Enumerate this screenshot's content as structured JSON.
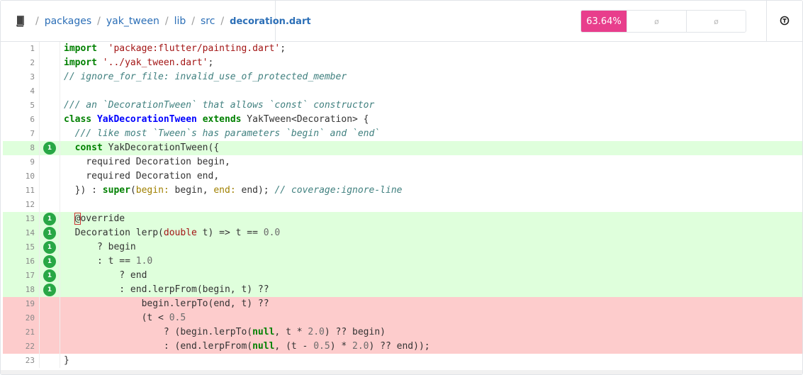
{
  "breadcrumb": {
    "items": [
      "packages",
      "yak_tween",
      "lib",
      "src"
    ],
    "separator": "/",
    "current": "decoration.dart"
  },
  "coverage": {
    "percent": "63.64%",
    "cell2": "ø",
    "cell3": "ø"
  },
  "colors": {
    "accent": "#e83e8c",
    "covered": "#dfffdc",
    "uncovered": "#fdcccc",
    "hit_badge": "#28a745",
    "link": "#2c6fb7"
  },
  "icons": {
    "repo": "book-icon",
    "settings": "circle-toggle-icon"
  },
  "lines": [
    {
      "n": "1",
      "hits": "",
      "status": "none"
    },
    {
      "n": "2",
      "hits": "",
      "status": "none"
    },
    {
      "n": "3",
      "hits": "",
      "status": "none"
    },
    {
      "n": "4",
      "hits": "",
      "status": "none"
    },
    {
      "n": "5",
      "hits": "",
      "status": "none"
    },
    {
      "n": "6",
      "hits": "",
      "status": "none"
    },
    {
      "n": "7",
      "hits": "",
      "status": "none"
    },
    {
      "n": "8",
      "hits": "1",
      "status": "covered"
    },
    {
      "n": "9",
      "hits": "",
      "status": "none"
    },
    {
      "n": "10",
      "hits": "",
      "status": "none"
    },
    {
      "n": "11",
      "hits": "",
      "status": "none"
    },
    {
      "n": "12",
      "hits": "",
      "status": "none"
    },
    {
      "n": "13",
      "hits": "1",
      "status": "covered"
    },
    {
      "n": "14",
      "hits": "1",
      "status": "covered"
    },
    {
      "n": "15",
      "hits": "1",
      "status": "covered"
    },
    {
      "n": "16",
      "hits": "1",
      "status": "covered"
    },
    {
      "n": "17",
      "hits": "1",
      "status": "covered"
    },
    {
      "n": "18",
      "hits": "1",
      "status": "covered"
    },
    {
      "n": "19",
      "hits": "",
      "status": "uncovered"
    },
    {
      "n": "20",
      "hits": "",
      "status": "uncovered"
    },
    {
      "n": "21",
      "hits": "",
      "status": "uncovered"
    },
    {
      "n": "22",
      "hits": "",
      "status": "uncovered"
    },
    {
      "n": "23",
      "hits": "",
      "status": "none"
    }
  ],
  "code": [
    [
      [
        "kw",
        "import"
      ],
      [
        "",
        "  "
      ],
      [
        "str",
        "'package:flutter/painting.dart'"
      ],
      [
        "",
        ";"
      ]
    ],
    [
      [
        "kw",
        "import"
      ],
      [
        "",
        " "
      ],
      [
        "str",
        "'../yak_tween.dart'"
      ],
      [
        "",
        ";"
      ]
    ],
    [
      [
        "cm",
        "// ignore_for_file: invalid_use_of_protected_member"
      ]
    ],
    [],
    [
      [
        "cm",
        "/// an `DecorationTween` that allows `const` constructor"
      ]
    ],
    [
      [
        "kw",
        "class"
      ],
      [
        "",
        " "
      ],
      [
        "cls",
        "YakDecorationTween"
      ],
      [
        "",
        " "
      ],
      [
        "kw",
        "extends"
      ],
      [
        "",
        " YakTween<Decoration> {"
      ]
    ],
    [
      [
        "cm",
        "  /// like most `Tween`s has parameters `begin` and `end`"
      ]
    ],
    [
      [
        "",
        "  "
      ],
      [
        "kw",
        "const"
      ],
      [
        "",
        " YakDecorationTween({"
      ]
    ],
    [
      [
        "",
        "    required Decoration begin,"
      ]
    ],
    [
      [
        "",
        "    required Decoration end,"
      ]
    ],
    [
      [
        "",
        "  }) : "
      ],
      [
        "kw",
        "super"
      ],
      [
        "",
        "("
      ],
      [
        "named",
        "begin:"
      ],
      [
        "",
        " begin, "
      ],
      [
        "named",
        "end:"
      ],
      [
        "",
        " end); "
      ],
      [
        "cm",
        "// coverage:ignore-line"
      ]
    ],
    [],
    [
      [
        "",
        "  "
      ],
      [
        "cursor",
        "@"
      ],
      [
        "",
        "override"
      ]
    ],
    [
      [
        "",
        "  Decoration lerp("
      ],
      [
        "ty",
        "double"
      ],
      [
        "",
        " t) => t == "
      ],
      [
        "num",
        "0.0"
      ]
    ],
    [
      [
        "",
        "      ? begin"
      ]
    ],
    [
      [
        "",
        "      : t == "
      ],
      [
        "num",
        "1.0"
      ]
    ],
    [
      [
        "",
        "          ? end"
      ]
    ],
    [
      [
        "",
        "          : end.lerpFrom(begin, t) ??"
      ]
    ],
    [
      [
        "",
        "              begin.lerpTo(end, t) ??"
      ]
    ],
    [
      [
        "",
        "              (t < "
      ],
      [
        "num",
        "0.5"
      ]
    ],
    [
      [
        "",
        "                  ? (begin.lerpTo("
      ],
      [
        "kw",
        "null"
      ],
      [
        "",
        ", t * "
      ],
      [
        "num",
        "2.0"
      ],
      [
        "",
        ") ?? begin)"
      ]
    ],
    [
      [
        "",
        "                  : (end.lerpFrom("
      ],
      [
        "kw",
        "null"
      ],
      [
        "",
        ", (t - "
      ],
      [
        "num",
        "0.5"
      ],
      [
        "",
        ") * "
      ],
      [
        "num",
        "2.0"
      ],
      [
        "",
        ") ?? end));"
      ]
    ],
    [
      [
        "",
        "}"
      ]
    ]
  ]
}
